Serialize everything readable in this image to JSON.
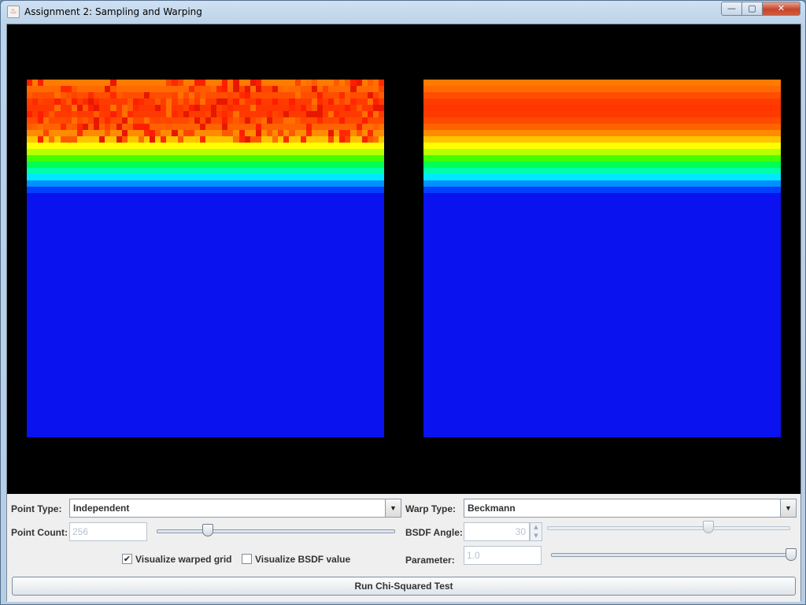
{
  "window": {
    "title": "Assignment 2: Sampling and Warping",
    "controls": {
      "minimize": "—",
      "maximize": "▢",
      "close": "✕"
    }
  },
  "colors": {
    "band_top": [
      "#ff7a00",
      "#ff6a00",
      "#ff4e00",
      "#ff3c00",
      "#ff3600",
      "#ff3a00",
      "#ff4a00",
      "#ff6200",
      "#ff8c00",
      "#ffc400",
      "#ffff00",
      "#b8ff00",
      "#44ff00",
      "#00ff55",
      "#00ffa8",
      "#00e8ff",
      "#0090ff",
      "#0040ff",
      "#0a12f0"
    ],
    "body": "#0a12f0"
  },
  "controls": {
    "point_type": {
      "label": "Point Type:",
      "value": "Independent"
    },
    "warp_type": {
      "label": "Warp Type:",
      "value": "Beckmann"
    },
    "point_count": {
      "label": "Point Count:",
      "value": "256",
      "slider_fraction": 0.2
    },
    "bsdf_angle": {
      "label": "BSDF Angle:",
      "value": "30",
      "slider_fraction": 0.67
    },
    "visualize_grid": {
      "label": "Visualize warped grid",
      "checked": true
    },
    "visualize_bsdf": {
      "label": "Visualize BSDF value",
      "checked": false
    },
    "parameter": {
      "label": "Parameter:",
      "value": "1.0",
      "slider_fraction": 1.0
    },
    "run_button": "Run Chi-Squared Test"
  }
}
